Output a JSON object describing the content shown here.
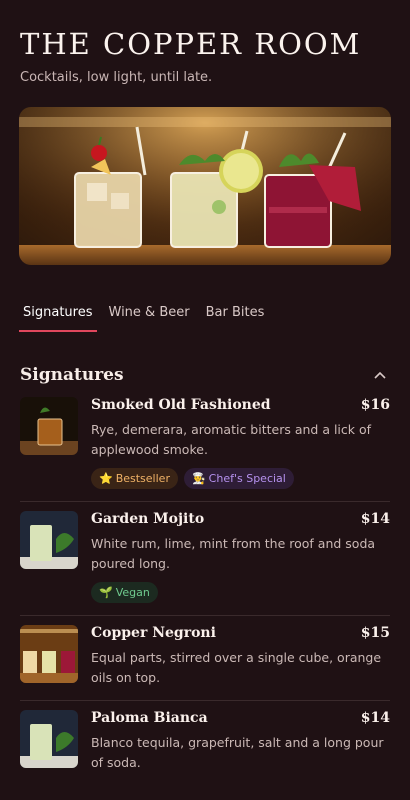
{
  "header": {
    "title": "THE COPPER ROOM",
    "tagline": "Cocktails, low light, until late."
  },
  "tabs": [
    {
      "label": "Signatures",
      "active": true
    },
    {
      "label": "Wine & Beer",
      "active": false
    },
    {
      "label": "Bar Bites",
      "active": false
    }
  ],
  "section": {
    "title": "Signatures",
    "items": [
      {
        "name": "Smoked Old Fashioned",
        "price": "$16",
        "description": "Rye, demerara, aromatic bitters and a lick of applewood smoke.",
        "badges": [
          {
            "label": "Bestseller",
            "icon": "star-icon",
            "glyph": "⭐"
          },
          {
            "label": "Chef's Special",
            "icon": "chef-hat-icon",
            "glyph": "👨‍🍳"
          }
        ]
      },
      {
        "name": "Garden Mojito",
        "price": "$14",
        "description": "White rum, lime, mint from the roof and soda poured long.",
        "badges": [
          {
            "label": "Vegan",
            "icon": "sprout-icon",
            "glyph": "🌱"
          }
        ]
      },
      {
        "name": "Copper Negroni",
        "price": "$15",
        "description": "Equal parts, stirred over a single cube, orange oils on top.",
        "badges": []
      },
      {
        "name": "Paloma Bianca",
        "price": "$14",
        "description": "Blanco tequila, grapefruit, salt and a long pour of soda.",
        "badges": []
      }
    ]
  },
  "colors": {
    "background": "#1f1114",
    "accent": "#e0475d"
  }
}
